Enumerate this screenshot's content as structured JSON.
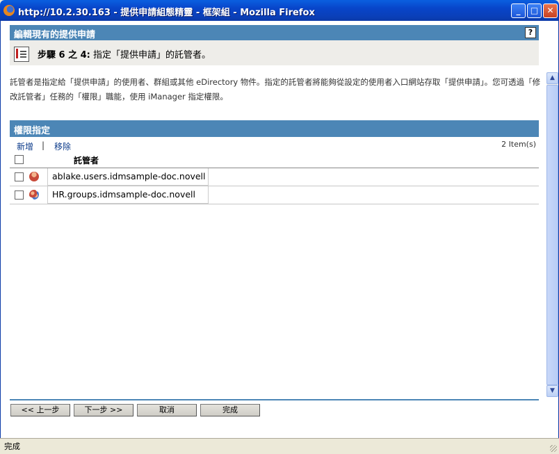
{
  "window": {
    "title": "http://10.2.30.163 - 提供申請組態精靈 - 框架組 - Mozilla Firefox",
    "minimize_glyph": "_",
    "maximize_glyph": "□",
    "close_glyph": "✕"
  },
  "page": {
    "header_title": "編輯現有的提供申請",
    "help_label": "?",
    "step_prefix": "步驟 6 之 4:",
    "step_text": "指定「提供申請」的託管者。",
    "description": "託管者是指定給「提供申請」的使用者、群組或其他 eDirectory 物件。指定的託管者將能夠從設定的使用者入口網站存取「提供申請」。您可透過「修改託管者」任務的「權限」職能，使用 iManager 指定權限。"
  },
  "permissions": {
    "section_title": "權限指定",
    "add_label": "新增",
    "separator": "|",
    "remove_label": "移除",
    "item_count": "2 Item(s)",
    "column_trustee": "託管者",
    "rows": [
      {
        "icon": "user-icon",
        "name": "ablake.users.idmsample-doc.novell"
      },
      {
        "icon": "group-icon",
        "name": "HR.groups.idmsample-doc.novell"
      }
    ]
  },
  "buttons": {
    "prev": "<< 上一步",
    "next": "下一步 >>",
    "cancel": "取消",
    "finish": "完成"
  },
  "scrollbar": {
    "up_glyph": "▲",
    "down_glyph": "▼"
  },
  "status": {
    "text": "完成"
  }
}
